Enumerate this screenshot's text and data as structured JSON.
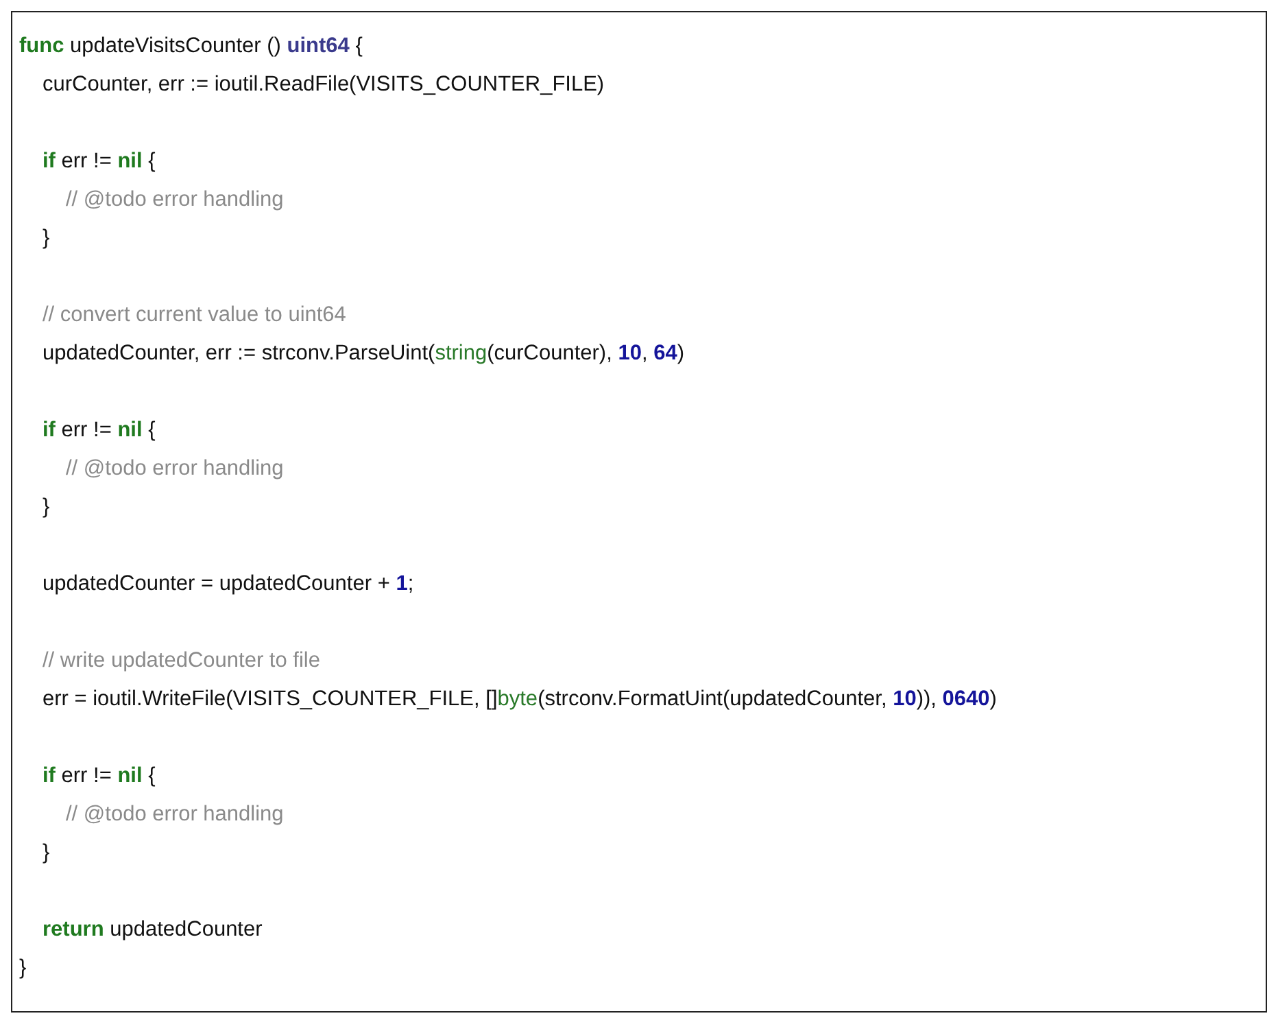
{
  "code_lines": [
    {
      "kind": "code",
      "tokens": [
        {
          "kind": "keyword",
          "text": "func"
        },
        {
          "kind": "plain",
          "text": " updateVisitsCounter () "
        },
        {
          "kind": "type",
          "text": "uint64"
        },
        {
          "kind": "plain",
          "text": " {"
        }
      ],
      "children": [
        {
          "kind": "code",
          "tokens": [
            {
              "kind": "plain",
              "text": "curCounter, err := ioutil.ReadFile(VISITS_COUNTER_FILE)"
            }
          ]
        },
        {
          "kind": "blank"
        },
        {
          "kind": "code",
          "tokens": [
            {
              "kind": "keyword",
              "text": "if"
            },
            {
              "kind": "plain",
              "text": " err != "
            },
            {
              "kind": "keyword",
              "text": "nil"
            },
            {
              "kind": "plain",
              "text": " {"
            }
          ],
          "children": [
            {
              "kind": "code",
              "tokens": [
                {
                  "kind": "comment",
                  "text": "// @todo error handling"
                }
              ]
            }
          ]
        },
        {
          "kind": "code",
          "tokens": [
            {
              "kind": "plain",
              "text": "}"
            }
          ]
        },
        {
          "kind": "blank"
        },
        {
          "kind": "code",
          "tokens": [
            {
              "kind": "comment",
              "text": "// convert current value to uint64"
            }
          ]
        },
        {
          "kind": "code",
          "tokens": [
            {
              "kind": "plain",
              "text": "updatedCounter, err := strconv.ParseUint("
            },
            {
              "kind": "builtin",
              "text": "string"
            },
            {
              "kind": "plain",
              "text": "(curCounter), "
            },
            {
              "kind": "number",
              "text": "10"
            },
            {
              "kind": "plain",
              "text": ", "
            },
            {
              "kind": "number",
              "text": "64"
            },
            {
              "kind": "plain",
              "text": ")"
            }
          ]
        },
        {
          "kind": "blank"
        },
        {
          "kind": "code",
          "tokens": [
            {
              "kind": "keyword",
              "text": "if"
            },
            {
              "kind": "plain",
              "text": " err != "
            },
            {
              "kind": "keyword",
              "text": "nil"
            },
            {
              "kind": "plain",
              "text": " {"
            }
          ],
          "children": [
            {
              "kind": "code",
              "tokens": [
                {
                  "kind": "comment",
                  "text": "// @todo error handling"
                }
              ]
            }
          ]
        },
        {
          "kind": "code",
          "tokens": [
            {
              "kind": "plain",
              "text": "}"
            }
          ]
        },
        {
          "kind": "blank"
        },
        {
          "kind": "code",
          "tokens": [
            {
              "kind": "plain",
              "text": "updatedCounter = updatedCounter + "
            },
            {
              "kind": "number",
              "text": "1"
            },
            {
              "kind": "plain",
              "text": ";"
            }
          ]
        },
        {
          "kind": "blank"
        },
        {
          "kind": "code",
          "tokens": [
            {
              "kind": "comment",
              "text": "// write updatedCounter to file"
            }
          ]
        },
        {
          "kind": "code",
          "tokens": [
            {
              "kind": "plain",
              "text": "err = ioutil.WriteFile(VISITS_COUNTER_FILE, []"
            },
            {
              "kind": "builtin",
              "text": "byte"
            },
            {
              "kind": "plain",
              "text": "(strconv.FormatUint(updatedCounter, "
            },
            {
              "kind": "number",
              "text": "10"
            },
            {
              "kind": "plain",
              "text": ")), "
            },
            {
              "kind": "number",
              "text": "0640"
            },
            {
              "kind": "plain",
              "text": ")"
            }
          ]
        },
        {
          "kind": "blank"
        },
        {
          "kind": "code",
          "tokens": [
            {
              "kind": "keyword",
              "text": "if"
            },
            {
              "kind": "plain",
              "text": " err != "
            },
            {
              "kind": "keyword",
              "text": "nil"
            },
            {
              "kind": "plain",
              "text": " {"
            }
          ],
          "children": [
            {
              "kind": "code",
              "tokens": [
                {
                  "kind": "comment",
                  "text": "// @todo error handling"
                }
              ]
            }
          ]
        },
        {
          "kind": "code",
          "tokens": [
            {
              "kind": "plain",
              "text": "}"
            }
          ]
        },
        {
          "kind": "blank"
        },
        {
          "kind": "code",
          "tokens": [
            {
              "kind": "keyword",
              "text": "return"
            },
            {
              "kind": "plain",
              "text": " updatedCounter"
            }
          ]
        }
      ]
    },
    {
      "kind": "code",
      "tokens": [
        {
          "kind": "plain",
          "text": "}"
        }
      ]
    }
  ]
}
